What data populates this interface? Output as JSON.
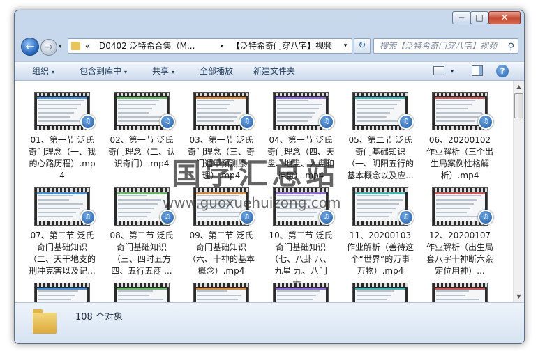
{
  "window": {
    "minimize": "─",
    "maximize": "□",
    "close": "✕"
  },
  "nav": {
    "back": "←",
    "forward": "→",
    "history": "▾"
  },
  "address": {
    "chevron": "«",
    "segment1": "D0402 泛特希合集（M...",
    "arrow": "▸",
    "segment2": "【泛特希奇门穿八宅】视频",
    "dropdown": "▾"
  },
  "refresh": "↻",
  "search": {
    "placeholder": "搜索【泛特希奇门穿八宅】视频",
    "icon": "search-icon"
  },
  "toolbar": {
    "organize": "组织",
    "include": "包含到库中",
    "share": "共享",
    "play_all": "全部播放",
    "new_folder": "新建文件夹",
    "arrow": "▾"
  },
  "files": [
    {
      "name": "01、第一节 泛氏奇门理念（一、我的心路历程）.mp4"
    },
    {
      "name": "02、第一节 泛氏奇门理念（二、认识奇门）.mp4"
    },
    {
      "name": "03、第一节 泛氏奇门理念（三、奇门遁甲预测原理）.mp4"
    },
    {
      "name": "04、第一节 泛氏奇门理念（四、天盘、地盘、人盘和神盘）.mp4"
    },
    {
      "name": "05、第二节 泛氏奇门基础知识（一、阴阳五行的基本概念以及应..."
    },
    {
      "name": "06、20200102作业解析（三个出生局案例性格解析）.mp4"
    },
    {
      "name": "07、第二节 泛氏奇门基础知识（二、天干地支的刑冲克害以及记..."
    },
    {
      "name": "08、第二节 泛氏奇门基础知识（三、四时五方四、五行五商 ..."
    },
    {
      "name": "09、第二节 泛氏奇门基础知识（六、十神的基本概念）.mp4"
    },
    {
      "name": "10、第二节 泛氏奇门基础知识（七、八卦 八、九星 九、八门 十..."
    },
    {
      "name": "11、20200103作业解析（善待这个“世界”的万事万物）.mp4"
    },
    {
      "name": "12、20200107作业解析（出生局套八字十神断六亲定位用神）..."
    },
    {
      "name": ""
    },
    {
      "name": ""
    },
    {
      "name": ""
    },
    {
      "name": ""
    },
    {
      "name": ""
    },
    {
      "name": ""
    }
  ],
  "scrollbar": {
    "up": "▲",
    "down": "▼"
  },
  "watermark": {
    "text": "国学汇总站",
    "url": "www.guoxuehuizong.com"
  },
  "status": {
    "count": "108 个对象"
  }
}
